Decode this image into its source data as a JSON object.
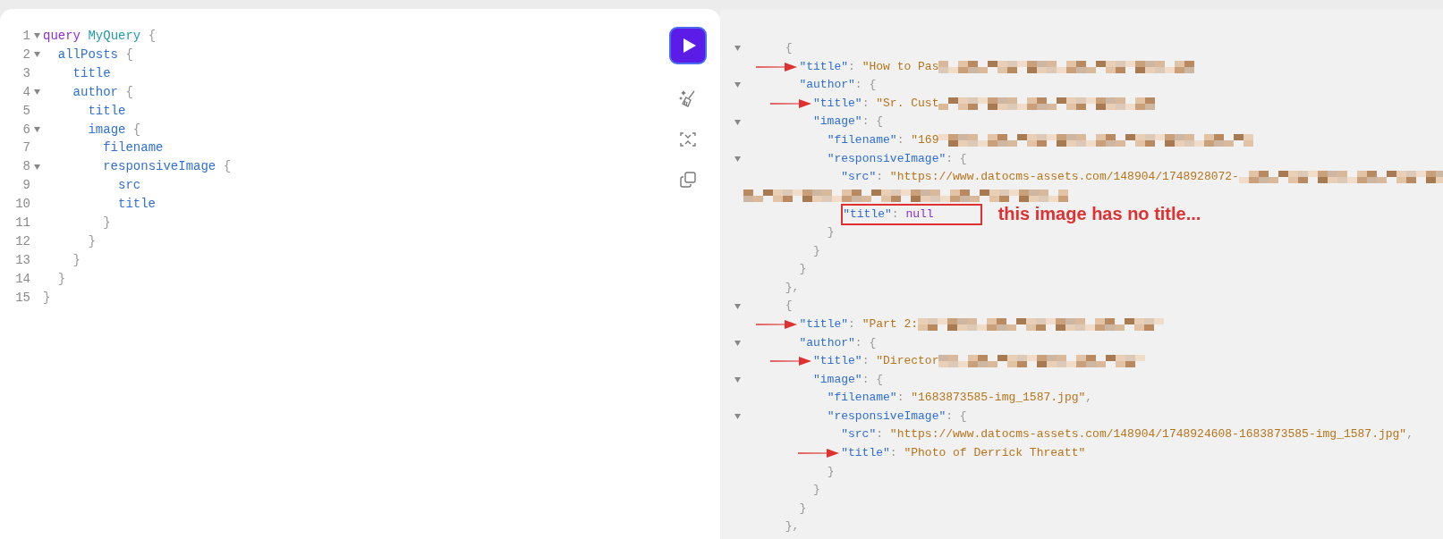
{
  "editor": {
    "lines": [
      {
        "number": "1",
        "code": "query MyQuery {",
        "foldable": true,
        "kind": "operation"
      },
      {
        "number": "2",
        "code": "  allPosts {",
        "foldable": true
      },
      {
        "number": "3",
        "code": "    title",
        "foldable": false
      },
      {
        "number": "4",
        "code": "    author {",
        "foldable": true
      },
      {
        "number": "5",
        "code": "      title",
        "foldable": false
      },
      {
        "number": "6",
        "code": "      image {",
        "foldable": true
      },
      {
        "number": "7",
        "code": "        filename",
        "foldable": false
      },
      {
        "number": "8",
        "code": "        responsiveImage {",
        "foldable": true
      },
      {
        "number": "9",
        "code": "          src",
        "foldable": false
      },
      {
        "number": "10",
        "code": "          title",
        "foldable": false
      },
      {
        "number": "11",
        "code": "        }",
        "foldable": false
      },
      {
        "number": "12",
        "code": "      }",
        "foldable": false
      },
      {
        "number": "13",
        "code": "    }",
        "foldable": false
      },
      {
        "number": "14",
        "code": "  }",
        "foldable": false
      },
      {
        "number": "15",
        "code": "}",
        "foldable": false
      }
    ]
  },
  "toolbar": {
    "buttons": [
      {
        "kind": "run"
      },
      {
        "kind": "prettify"
      },
      {
        "kind": "merge"
      },
      {
        "kind": "copy"
      }
    ]
  },
  "result": {
    "lines": [
      {
        "code": "      {",
        "foldable": true,
        "redacted": false,
        "arrow": false
      },
      {
        "code": "        \"title\": \"How to Pas",
        "foldable": false,
        "redacted": true,
        "arrow": true
      },
      {
        "code": "        \"author\": {",
        "foldable": true,
        "redacted": false,
        "arrow": false
      },
      {
        "code": "          \"title\": \"Sr. Cust",
        "foldable": false,
        "redacted": true,
        "arrow": true
      },
      {
        "code": "          \"image\": {",
        "foldable": true,
        "redacted": false,
        "arrow": false
      },
      {
        "code": "            \"filename\": \"169",
        "foldable": false,
        "redacted": true,
        "arrow": false
      },
      {
        "code": "            \"responsiveImage\": {",
        "foldable": true,
        "redacted": false,
        "arrow": false
      },
      {
        "code": "              \"src\": \"https://www.datocms-assets.com/148904/1748928072-",
        "foldable": false,
        "redacted": true,
        "arrow": false
      },
      {
        "foldable": false,
        "redacted": true,
        "arrow": false
      },
      {
        "code": "              \"title\": null",
        "foldable": false,
        "redacted": false,
        "arrow": false,
        "boxed": true,
        "note": "this image has no title..."
      },
      {
        "code": "            }",
        "foldable": false,
        "redacted": false,
        "arrow": false
      },
      {
        "code": "          }",
        "foldable": false,
        "redacted": false,
        "arrow": false
      },
      {
        "code": "        }",
        "foldable": false,
        "redacted": false,
        "arrow": false
      },
      {
        "code": "      },",
        "foldable": false,
        "redacted": false,
        "arrow": false
      },
      {
        "code": "      {",
        "foldable": true,
        "redacted": false,
        "arrow": false
      },
      {
        "code": "        \"title\": \"Part 2:",
        "foldable": false,
        "redacted": true,
        "arrow": true
      },
      {
        "code": "        \"author\": {",
        "foldable": true,
        "redacted": false,
        "arrow": false
      },
      {
        "code": "          \"title\": \"Director",
        "foldable": false,
        "redacted": true,
        "arrow": true
      },
      {
        "code": "          \"image\": {",
        "foldable": true,
        "redacted": false,
        "arrow": false
      },
      {
        "code": "            \"filename\": \"1683873585-img_1587.jpg\",",
        "foldable": false,
        "redacted": false,
        "arrow": false
      },
      {
        "code": "            \"responsiveImage\": {",
        "foldable": true,
        "redacted": false,
        "arrow": false
      },
      {
        "code": "              \"src\": \"https://www.datocms-assets.com/148904/1748924608-1683873585-img_1587.jpg\",",
        "foldable": false,
        "redacted": false,
        "arrow": false
      },
      {
        "code": "              \"title\": \"Photo of Derrick Threatt\"",
        "foldable": false,
        "redacted": false,
        "arrow": true
      },
      {
        "code": "            }",
        "foldable": false,
        "redacted": false,
        "arrow": false
      },
      {
        "code": "          }",
        "foldable": false,
        "redacted": false,
        "arrow": false
      },
      {
        "code": "        }",
        "foldable": false,
        "redacted": false,
        "arrow": false
      },
      {
        "code": "      },",
        "foldable": false,
        "redacted": false,
        "arrow": false
      }
    ]
  }
}
